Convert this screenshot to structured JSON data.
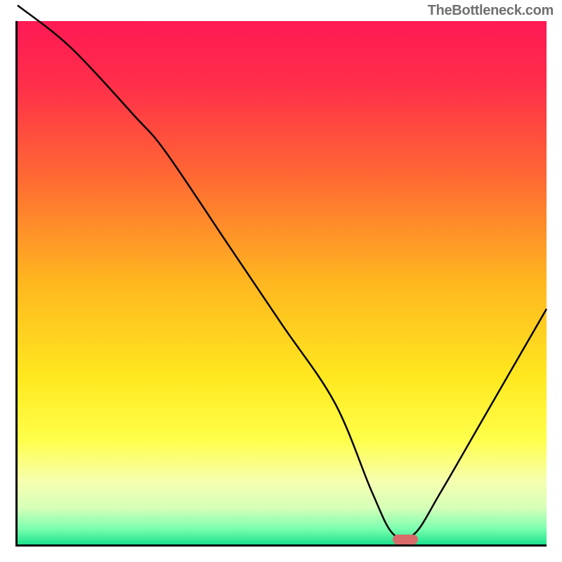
{
  "watermark": "TheBottleneck.com",
  "chart_data": {
    "type": "line",
    "title": "",
    "xlabel": "",
    "ylabel": "",
    "xlim": [
      0,
      100
    ],
    "ylim": [
      0,
      100
    ],
    "x": [
      0,
      10,
      22,
      28,
      40,
      50,
      60,
      67,
      71,
      75,
      80,
      88,
      100
    ],
    "values": [
      103,
      95,
      82,
      75,
      57,
      42,
      27,
      10,
      2,
      2,
      10,
      24,
      45
    ],
    "marker": {
      "x": 73,
      "y": 1.3
    },
    "gradient_stops": [
      {
        "offset": 0,
        "color": "#ff1a55"
      },
      {
        "offset": 0.12,
        "color": "#ff2e4a"
      },
      {
        "offset": 0.3,
        "color": "#ff6a33"
      },
      {
        "offset": 0.5,
        "color": "#ffb71f"
      },
      {
        "offset": 0.68,
        "color": "#ffe81f"
      },
      {
        "offset": 0.8,
        "color": "#ffff4a"
      },
      {
        "offset": 0.88,
        "color": "#f6ffb0"
      },
      {
        "offset": 0.93,
        "color": "#d6ffb8"
      },
      {
        "offset": 0.97,
        "color": "#7bffb0"
      },
      {
        "offset": 1.0,
        "color": "#1de28c"
      }
    ]
  }
}
